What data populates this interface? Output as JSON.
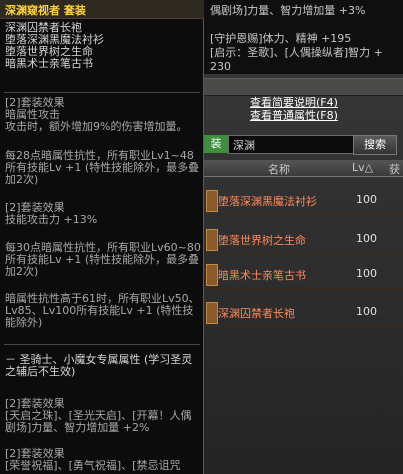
{
  "tooltip": {
    "title": "深渊窥视者 套装",
    "set_items": [
      "深渊囚禁者长袍",
      "堕落深渊黑魔法衬衫",
      "堕落世界树之生命",
      "暗黑术士亲笔古书"
    ],
    "effect2_header": "[2]套装效果",
    "effect2_lines": [
      "暗属性攻击",
      "攻击时，额外增加9%的伤害增加量。"
    ],
    "effect28": "每28点暗属性抗性，所有职业Lv1~48所有技能Lv +1 (特性技能除外，最多叠加2次)",
    "effect2b_header": "[2]套装效果",
    "effect2b_line": "技能攻击力 +13%",
    "effect30": "每30点暗属性抗性，所有职业Lv60~80所有技能Lv +1 (特性技能除外，最多叠加2次)",
    "effect61": "暗属性抗性高于61时，所有职业Lv50、Lv85、Lv100所有技能Lv +1 (特性技能除外)",
    "special": "－ 圣骑士、小魔女专属属性 (学习圣灵之辅后不生效)",
    "effect2c_header": "[2]套装效果",
    "effect2c_line": "[天启之珠]、[圣光天启]、[开幕！人偶剧场]力量、智力增加量 +2%",
    "effect2d_header": "[2]套装效果",
    "effect2d_line": "[荣誉祝福]、[勇气祝福]、[禁忌诅咒"
  },
  "right_tip": {
    "lines": [
      "偶剧场]力量、智力增加量 +3%",
      "",
      "[守护恩赐]体力、精神 +195",
      "[启示：圣歌]、[人偶操纵者]智力 +",
      "230"
    ]
  },
  "links": [
    "查看简要说明(F4)",
    "查看普通属性(F8)"
  ],
  "search": {
    "tag": "装",
    "value": "深渊",
    "button": "搜索"
  },
  "table": {
    "headers": {
      "name": "名称",
      "lv": "Lv△",
      "extra": "获"
    },
    "rows": [
      {
        "name": "堕落深渊黑魔法衬衫",
        "lv": "100"
      },
      {
        "name": "堕落世界树之生命",
        "lv": "100"
      },
      {
        "name": "暗黑术士亲笔古书",
        "lv": "100"
      },
      {
        "name": "深渊囚禁者长袍",
        "lv": "100"
      }
    ]
  }
}
